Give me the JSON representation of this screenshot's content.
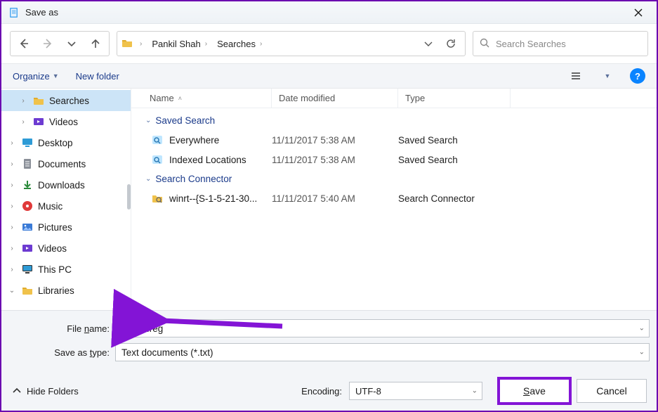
{
  "titlebar": {
    "title": "Save as"
  },
  "nav": {
    "back_icon": "arrow-left",
    "forward_icon": "arrow-right",
    "recent_icon": "chevron-down",
    "up_icon": "arrow-up"
  },
  "breadcrumb": [
    {
      "label": "Pankil Shah"
    },
    {
      "label": "Searches"
    }
  ],
  "address_actions": {
    "history_icon": "chevron-down",
    "refresh_icon": "refresh"
  },
  "search": {
    "placeholder": "Search Searches"
  },
  "commandbar": {
    "organize": "Organize",
    "new_folder": "New folder",
    "view_icon": "view-list",
    "view_drop_icon": "caret-down",
    "help": "?"
  },
  "tree": [
    {
      "id": "searches",
      "label": "Searches",
      "icon": "folder",
      "expander": ">",
      "indent": true,
      "selected": true
    },
    {
      "id": "videos1",
      "label": "Videos",
      "icon": "video",
      "expander": ">",
      "indent": true
    },
    {
      "id": "desktop",
      "label": "Desktop",
      "icon": "monitor",
      "expander": ">"
    },
    {
      "id": "documents",
      "label": "Documents",
      "icon": "doc",
      "expander": ">"
    },
    {
      "id": "downloads",
      "label": "Downloads",
      "icon": "download",
      "expander": ">"
    },
    {
      "id": "music",
      "label": "Music",
      "icon": "music",
      "expander": ">"
    },
    {
      "id": "pictures",
      "label": "Pictures",
      "icon": "picture",
      "expander": ">"
    },
    {
      "id": "videos2",
      "label": "Videos",
      "icon": "video",
      "expander": ">"
    },
    {
      "id": "thispc",
      "label": "This PC",
      "icon": "pc",
      "expander": ">"
    },
    {
      "id": "libraries",
      "label": "Libraries",
      "icon": "folder",
      "expander": "v"
    }
  ],
  "columns": {
    "name": "Name",
    "date": "Date modified",
    "type": "Type"
  },
  "groups": [
    {
      "title": "Saved Search",
      "rows": [
        {
          "name": "Everywhere",
          "date": "11/11/2017 5:38 AM",
          "type": "Saved Search",
          "icon": "saved-search"
        },
        {
          "name": "Indexed Locations",
          "date": "11/11/2017 5:38 AM",
          "type": "Saved Search",
          "icon": "saved-search"
        }
      ]
    },
    {
      "title": "Search Connector",
      "rows": [
        {
          "name": "winrt--{S-1-5-21-30...",
          "date": "11/11/2017 5:40 AM",
          "type": "Search Connector",
          "icon": "search-connector"
        }
      ]
    }
  ],
  "form": {
    "filename_label_pre": "File ",
    "filename_label_u": "n",
    "filename_label_post": "ame:",
    "filename_value": "Demo.reg",
    "savetype_label_pre": "Save as ",
    "savetype_label_u": "t",
    "savetype_label_post": "ype:",
    "savetype_value": "Text documents (*.txt)"
  },
  "footer": {
    "hide_folders": "Hide Folders",
    "encoding_label": "Encoding:",
    "encoding_value": "UTF-8",
    "save_pre": "",
    "save_u": "S",
    "save_post": "ave",
    "cancel": "Cancel"
  }
}
